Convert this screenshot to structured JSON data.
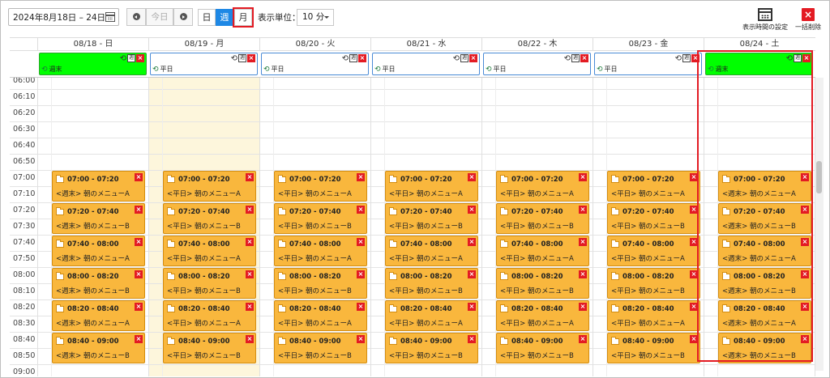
{
  "toolbar": {
    "date_range": "2024年8月18日 – 24日",
    "prev_icon": "circle-left-icon",
    "today_label": "今日",
    "next_icon": "circle-right-icon",
    "views": [
      {
        "label": "日",
        "active": false
      },
      {
        "label": "週",
        "active": true
      },
      {
        "label": "月",
        "active": false,
        "highlighted": true
      }
    ],
    "unit_label": "表示単位：",
    "unit_value": "10 分",
    "settings_label": "表示時間の設定",
    "delete_all_label": "一括削除"
  },
  "days": [
    {
      "header": "08/18 - 日",
      "allday": "週末",
      "type": "weekend"
    },
    {
      "header": "08/19 - 月",
      "allday": "平日",
      "type": "weekday",
      "today": true
    },
    {
      "header": "08/20 - 火",
      "allday": "平日",
      "type": "weekday"
    },
    {
      "header": "08/21 - 水",
      "allday": "平日",
      "type": "weekday"
    },
    {
      "header": "08/22 - 木",
      "allday": "平日",
      "type": "weekday"
    },
    {
      "header": "08/23 - 金",
      "allday": "平日",
      "type": "weekday"
    },
    {
      "header": "08/24 - 土",
      "allday": "週末",
      "type": "weekend",
      "selected": true
    }
  ],
  "times": [
    "06:00",
    "06:10",
    "06:20",
    "06:30",
    "06:40",
    "06:50",
    "07:00",
    "07:10",
    "07:20",
    "07:30",
    "07:40",
    "07:50",
    "08:00",
    "08:10",
    "08:20",
    "08:30",
    "08:40",
    "08:50",
    "09:00"
  ],
  "events": [
    [
      {
        "time": "07:00 - 07:20",
        "title": "<週末> 朝のメニューA"
      },
      {
        "time": "07:20 - 07:40",
        "title": "<週末> 朝のメニューB"
      },
      {
        "time": "07:40 - 08:00",
        "title": "<週末> 朝のメニューA"
      },
      {
        "time": "08:00 - 08:20",
        "title": "<週末> 朝のメニューB"
      },
      {
        "time": "08:20 - 08:40",
        "title": "<週末> 朝のメニューA"
      },
      {
        "time": "08:40 - 09:00",
        "title": "<週末> 朝のメニューB"
      }
    ],
    [
      {
        "time": "07:00 - 07:20",
        "title": "<平日> 朝のメニューA"
      },
      {
        "time": "07:20 - 07:40",
        "title": "<平日> 朝のメニューB"
      },
      {
        "time": "07:40 - 08:00",
        "title": "<平日> 朝のメニューA"
      },
      {
        "time": "08:00 - 08:20",
        "title": "<平日> 朝のメニューB"
      },
      {
        "time": "08:20 - 08:40",
        "title": "<平日> 朝のメニューA"
      },
      {
        "time": "08:40 - 09:00",
        "title": "<平日> 朝のメニューB"
      }
    ],
    [
      {
        "time": "07:00 - 07:20",
        "title": "<平日> 朝のメニューA"
      },
      {
        "time": "07:20 - 07:40",
        "title": "<平日> 朝のメニューB"
      },
      {
        "time": "07:40 - 08:00",
        "title": "<平日> 朝のメニューA"
      },
      {
        "time": "08:00 - 08:20",
        "title": "<平日> 朝のメニューB"
      },
      {
        "time": "08:20 - 08:40",
        "title": "<平日> 朝のメニューA"
      },
      {
        "time": "08:40 - 09:00",
        "title": "<平日> 朝のメニューB"
      }
    ],
    [
      {
        "time": "07:00 - 07:20",
        "title": "<平日> 朝のメニューA"
      },
      {
        "time": "07:20 - 07:40",
        "title": "<平日> 朝のメニューB"
      },
      {
        "time": "07:40 - 08:00",
        "title": "<平日> 朝のメニューA"
      },
      {
        "time": "08:00 - 08:20",
        "title": "<平日> 朝のメニューB"
      },
      {
        "time": "08:20 - 08:40",
        "title": "<平日> 朝のメニューA"
      },
      {
        "time": "08:40 - 09:00",
        "title": "<平日> 朝のメニューB"
      }
    ],
    [
      {
        "time": "07:00 - 07:20",
        "title": "<平日> 朝のメニューA"
      },
      {
        "time": "07:20 - 07:40",
        "title": "<平日> 朝のメニューB"
      },
      {
        "time": "07:40 - 08:00",
        "title": "<平日> 朝のメニューA"
      },
      {
        "time": "08:00 - 08:20",
        "title": "<平日> 朝のメニューB"
      },
      {
        "time": "08:20 - 08:40",
        "title": "<平日> 朝のメニューA"
      },
      {
        "time": "08:40 - 09:00",
        "title": "<平日> 朝のメニューB"
      }
    ],
    [
      {
        "time": "07:00 - 07:20",
        "title": "<平日> 朝のメニューA"
      },
      {
        "time": "07:20 - 07:40",
        "title": "<平日> 朝のメニューB"
      },
      {
        "time": "07:40 - 08:00",
        "title": "<平日> 朝のメニューA"
      },
      {
        "time": "08:00 - 08:20",
        "title": "<平日> 朝のメニューB"
      },
      {
        "time": "08:20 - 08:40",
        "title": "<平日> 朝のメニューA"
      },
      {
        "time": "08:40 - 09:00",
        "title": "<平日> 朝のメニューB"
      }
    ],
    [
      {
        "time": "07:00 - 07:20",
        "title": "<週末> 朝のメニューA"
      },
      {
        "time": "07:20 - 07:40",
        "title": "<週末> 朝のメニューB"
      },
      {
        "time": "07:40 - 08:00",
        "title": "<週末> 朝のメニューA"
      },
      {
        "time": "08:00 - 08:20",
        "title": "<週末> 朝のメニューB"
      },
      {
        "time": "08:20 - 08:40",
        "title": "<週末> 朝のメニューA"
      },
      {
        "time": "08:40 - 09:00",
        "title": "<週末> 朝のメニューB"
      }
    ]
  ],
  "colors": {
    "event_bg": "#f9b73d",
    "weekend_allday_bg": "#00ff00",
    "active_view": "#1e88e5",
    "highlight": "#e31b23",
    "today_bg": "#fdf6dc"
  }
}
